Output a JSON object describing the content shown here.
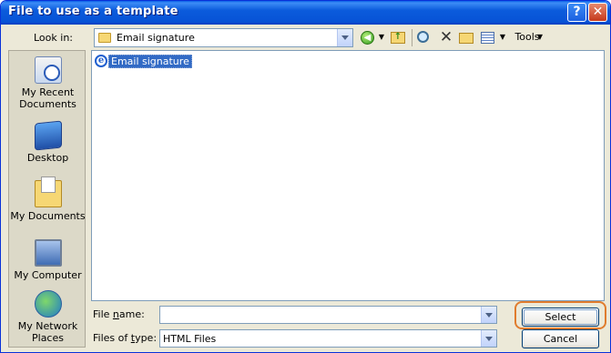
{
  "window": {
    "title": "File to use as a template",
    "help_label": "?",
    "close_label": "✕"
  },
  "lookin": {
    "label": "Look in:",
    "value": "Email signature"
  },
  "toolbar": {
    "tools_label": "Tools",
    "back_icon": "back-icon",
    "up_icon": "up-folder-icon",
    "search_icon": "search-web-icon",
    "delete_icon": "delete-icon",
    "newfolder_icon": "new-folder-icon",
    "views_icon": "views-icon"
  },
  "places": [
    {
      "label": "My Recent Documents",
      "icon": "recent-documents-icon"
    },
    {
      "label": "Desktop",
      "icon": "desktop-icon"
    },
    {
      "label": "My Documents",
      "icon": "my-documents-icon"
    },
    {
      "label": "My Computer",
      "icon": "my-computer-icon"
    },
    {
      "label": "My Network Places",
      "icon": "network-places-icon"
    }
  ],
  "files": [
    {
      "name": "Email signature",
      "icon": "internet-explorer-icon",
      "selected": true
    }
  ],
  "filename": {
    "label": "File name:",
    "value": ""
  },
  "filetype": {
    "label": "Files of type:",
    "value": "HTML Files"
  },
  "buttons": {
    "select": "Select",
    "cancel": "Cancel"
  },
  "colors": {
    "titlebar": "#0b5bdc",
    "selection": "#316ac5",
    "highlight": "#e07c2e"
  }
}
